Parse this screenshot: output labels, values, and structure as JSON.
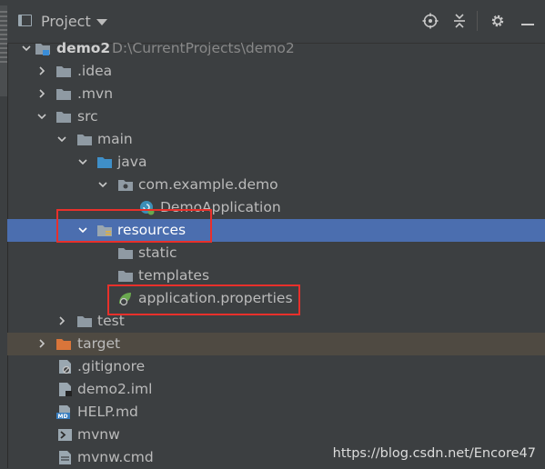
{
  "header": {
    "title": "Project",
    "icons": [
      "locate-icon",
      "collapse-all-icon",
      "gear-icon",
      "hide-icon"
    ]
  },
  "tree": [
    {
      "name": "demo2",
      "path": "D:\\CurrentProjects\\demo2",
      "icon": "module-folder-icon",
      "depth": 0,
      "expanded": true
    },
    {
      "name": ".idea",
      "icon": "folder-icon",
      "depth": 1,
      "expanded": false
    },
    {
      "name": ".mvn",
      "icon": "folder-icon",
      "depth": 1,
      "expanded": false
    },
    {
      "name": "src",
      "icon": "folder-icon",
      "depth": 1,
      "expanded": true
    },
    {
      "name": "main",
      "icon": "folder-icon",
      "depth": 2,
      "expanded": true
    },
    {
      "name": "java",
      "icon": "source-folder-icon",
      "depth": 3,
      "expanded": true
    },
    {
      "name": "com.example.demo",
      "icon": "package-icon",
      "depth": 4,
      "expanded": true
    },
    {
      "name": "DemoApplication",
      "icon": "spring-class-icon",
      "depth": 5
    },
    {
      "name": "resources",
      "icon": "resources-folder-icon",
      "depth": 3,
      "expanded": true,
      "selected": true
    },
    {
      "name": "static",
      "icon": "folder-icon",
      "depth": 4
    },
    {
      "name": "templates",
      "icon": "folder-icon",
      "depth": 4
    },
    {
      "name": "application.properties",
      "icon": "spring-properties-icon",
      "depth": 4
    },
    {
      "name": "test",
      "icon": "folder-icon",
      "depth": 2,
      "expanded": false
    },
    {
      "name": "target",
      "icon": "excluded-folder-icon",
      "depth": 1,
      "expanded": false
    },
    {
      "name": ".gitignore",
      "icon": "gitignore-file-icon",
      "depth": 1
    },
    {
      "name": "demo2.iml",
      "icon": "iml-file-icon",
      "depth": 1
    },
    {
      "name": "HELP.md",
      "icon": "markdown-file-icon",
      "depth": 1
    },
    {
      "name": "mvnw",
      "icon": "shell-file-icon",
      "depth": 1
    },
    {
      "name": "mvnw.cmd",
      "icon": "file-icon",
      "depth": 1
    }
  ],
  "watermark": "https://blog.csdn.net/Encore47",
  "colors": {
    "selection": "#4b6eaf",
    "highlight_box": "#e8302b",
    "background": "#3c3f41"
  }
}
